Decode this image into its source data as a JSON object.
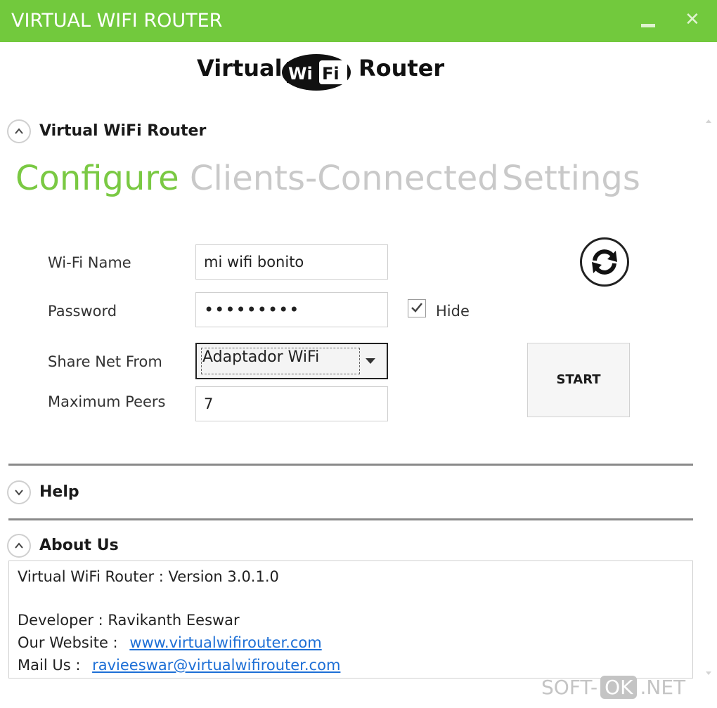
{
  "window": {
    "title": "VIRTUAL WIFI ROUTER",
    "minimize_icon": "minimize-icon",
    "close_label": "✕"
  },
  "logo": {
    "left_word": "Virtual",
    "badge_text_wi": "Wi",
    "badge_text_fi": "Fi",
    "right_word": "Router"
  },
  "sections": {
    "router": {
      "label": "Virtual WiFi Router",
      "state": "expanded"
    },
    "help": {
      "label": "Help",
      "state": "collapsed"
    },
    "about": {
      "label": "About Us",
      "state": "expanded"
    }
  },
  "tabs": [
    {
      "label": "Configure",
      "active": true
    },
    {
      "label": "Clients-Connected",
      "active": false
    },
    {
      "label": "Settings",
      "active": false
    }
  ],
  "form": {
    "wifi_name_label": "Wi-Fi Name",
    "wifi_name_value": "mi wifi bonito",
    "password_label": "Password",
    "password_value": "•••••••••",
    "hide_label": "Hide",
    "hide_checked": true,
    "share_from_label": "Share Net From",
    "share_from_value": "Adaptador WiFi",
    "max_peers_label": "Maximum Peers",
    "max_peers_value": "7",
    "start_label": "START",
    "refresh_icon": "refresh-icon"
  },
  "about": {
    "version_line": "Virtual WiFi Router : Version 3.0.1.0",
    "developer_line": "Developer : Ravikanth Eeswar",
    "website_label": "Our Website :",
    "website_link": "www.virtualwifirouter.com",
    "mail_label": "Mail Us :",
    "mail_link": "ravieeswar@virtualwifirouter.com"
  },
  "watermark": {
    "left": "SOFT-",
    "badge": "OK",
    "right": ".NET"
  },
  "colors": {
    "titlebar": "#72c93d",
    "active_tab": "#7ac943",
    "inactive_tab": "#c9c9c9",
    "link": "#1d6fd6"
  }
}
